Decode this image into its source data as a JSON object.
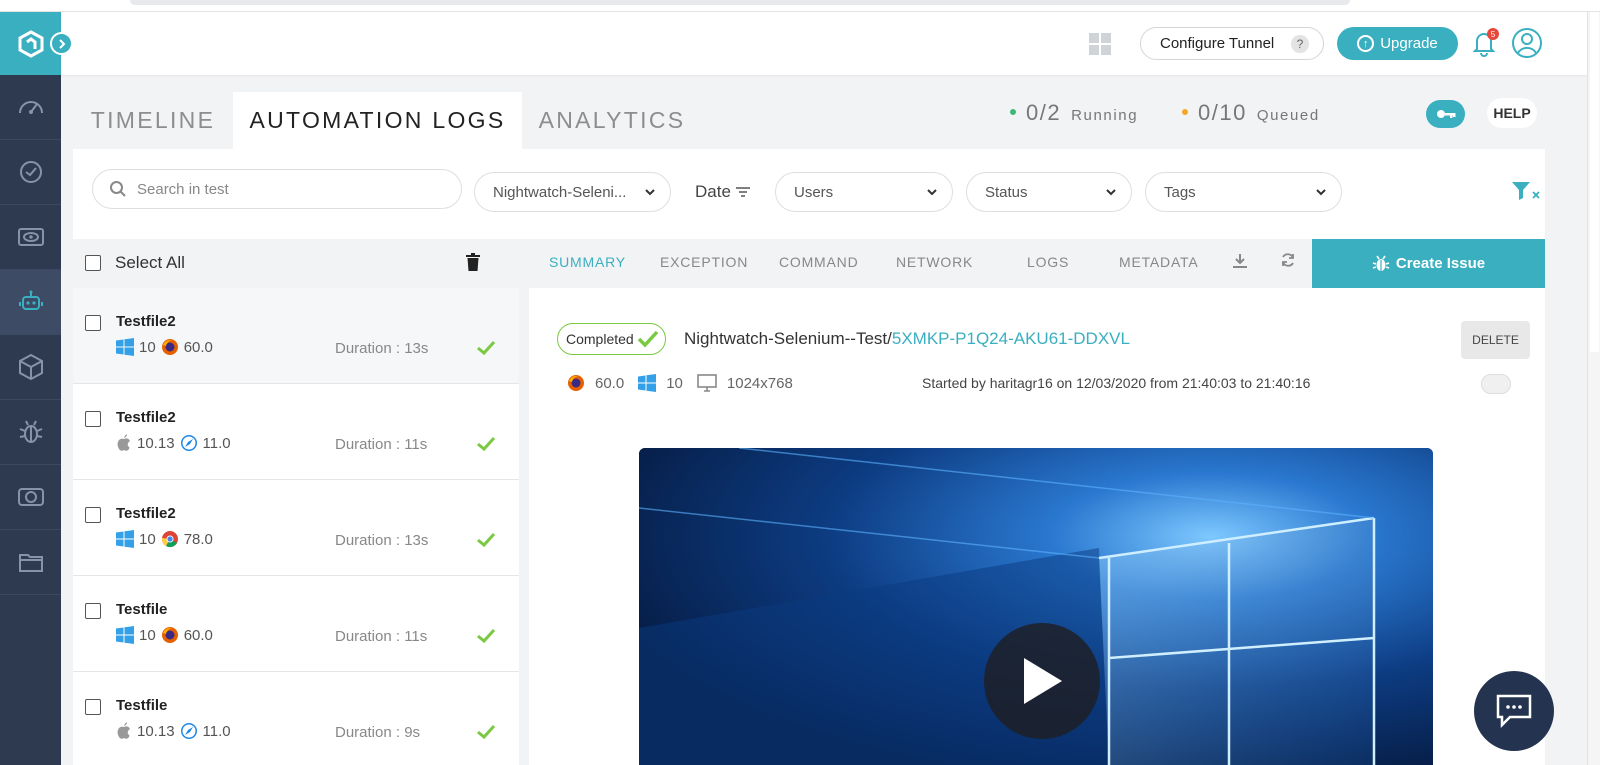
{
  "header": {
    "configure_tunnel": "Configure Tunnel",
    "help_mark": "?",
    "upgrade": "Upgrade",
    "notification_count": "5"
  },
  "tabs": [
    {
      "label": "TIMELINE"
    },
    {
      "label": "AUTOMATION LOGS"
    },
    {
      "label": "ANALYTICS"
    }
  ],
  "status": {
    "running_value": "0/2",
    "running_label": "Running",
    "queued_value": "0/10",
    "queued_label": "Queued",
    "running_color": "#3cb878",
    "queued_color": "#f5a623"
  },
  "help": "HELP",
  "filters": {
    "search_placeholder": "Search in test",
    "build": "Nightwatch-Seleni...",
    "date": "Date",
    "users": "Users",
    "status": "Status",
    "tags": "Tags"
  },
  "list": {
    "select_all": "Select All",
    "items": [
      {
        "name": "Testfile2",
        "os": "windows-icon",
        "os_version": "10",
        "browser": "firefox-icon",
        "browser_version": "60.0",
        "duration": "Duration : 13s"
      },
      {
        "name": "Testfile2",
        "os": "apple-icon",
        "os_version": "10.13",
        "browser": "safari-icon",
        "browser_version": "11.0",
        "duration": "Duration : 11s"
      },
      {
        "name": "Testfile2",
        "os": "windows-icon",
        "os_version": "10",
        "browser": "chrome-icon",
        "browser_version": "78.0",
        "duration": "Duration : 13s"
      },
      {
        "name": "Testfile",
        "os": "windows-icon",
        "os_version": "10",
        "browser": "firefox-icon",
        "browser_version": "60.0",
        "duration": "Duration : 11s"
      },
      {
        "name": "Testfile",
        "os": "apple-icon",
        "os_version": "10.13",
        "browser": "safari-icon",
        "browser_version": "11.0",
        "duration": "Duration : 9s"
      }
    ]
  },
  "detail": {
    "tabs": [
      "SUMMARY",
      "EXCEPTION",
      "COMMAND",
      "NETWORK",
      "LOGS",
      "METADATA"
    ],
    "create_issue": "Create Issue",
    "status_badge": "Completed",
    "build_name": "Nightwatch-Selenium--Test/",
    "test_id": "5XMKP-P1Q24-AKU61-DDXVL",
    "delete": "DELETE",
    "browser_version": "60.0",
    "os_version": "10",
    "resolution": "1024x768",
    "started_by": "Started by haritagr16 on 12/03/2020 from 21:40:03 to 21:40:16"
  },
  "colors": {
    "accent": "#3aafc0",
    "sidebar": "#2e3a4f",
    "success": "#7ac943"
  }
}
